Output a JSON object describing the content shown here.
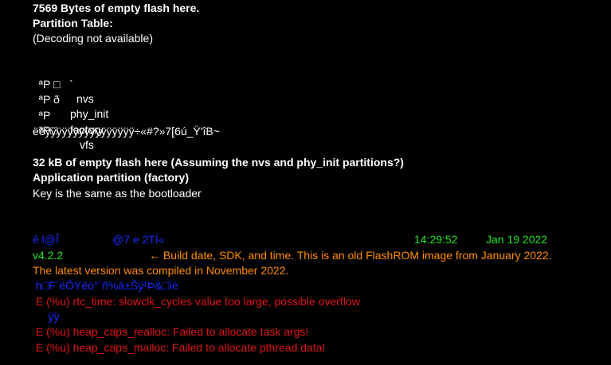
{
  "header": {
    "empty_flash": "7569 Bytes of empty flash here.",
    "partition_table": "Partition Table:",
    "decoding_note": "(Decoding not available)"
  },
  "partitions": [
    {
      "prefix": "ªP □   `",
      "name": "nvs"
    },
    {
      "prefix": "ªP ð",
      "name": "phy_init"
    },
    {
      "prefix": "ªP",
      "name": "factory"
    },
    {
      "prefix": "ªP□",
      "name": "vfs"
    }
  ],
  "garbage_line": "ëëÿÿÿÿÿÿÿÿÿÿÿÿÿÿÿÿ÷«#?»7[6ú_Ÿ'îB~",
  "section2": {
    "empty_flash_32k": "32 kB of empty flash here (Assuming the nvs and phy_init partitions?)",
    "app_partition": "Application partition (factory)",
    "key_note": "Key is the same as the bootloader"
  },
  "build_info": {
    "garbage_a": "ê l@Î",
    "garbage_b": "@7 e 2TÍ«",
    "time": "14:29:52",
    "date": "Jan 19 2022",
    "sdk_version": "v4.2.2",
    "annotation_1": "← Build date, SDK, and time. This is an old FlashROM image from January 2022.",
    "annotation_2": "The latest version was compiled in November 2022."
  },
  "log": {
    "garbage_blue": " h□F´ëÔYëò°´ñ%â±Šÿ¹Þ&□ìè",
    "error_1": " E (%u) rtc_time: slowclk_cycles value too large, possible overflow",
    "garbage_yy": "     ÿÿ",
    "error_2": " E (%u) heap_caps_realloc: Failed to allocate task args!",
    "error_3": " E (%u) heap_caps_malloc: Failed to allocate pthread data!"
  },
  "colors": {
    "background": "#000000",
    "text": "#ffffff",
    "blue": "#1a2cff",
    "green": "#1ee51e",
    "orange": "#ff8c00",
    "red": "#e01414"
  }
}
